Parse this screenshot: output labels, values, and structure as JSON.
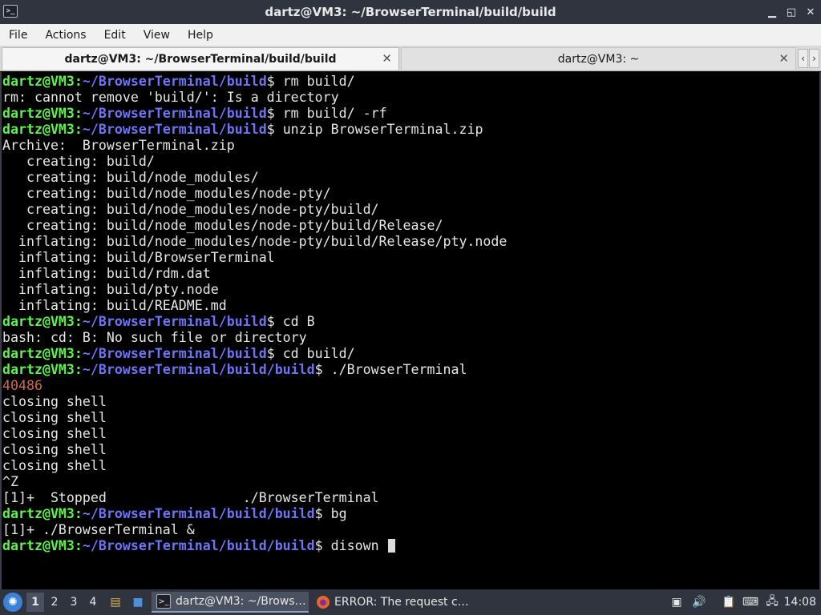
{
  "window": {
    "title": "dartz@VM3: ~/BrowserTerminal/build/build",
    "buttons": {
      "minimize": "▁",
      "maximize": "◱",
      "close": "✕"
    }
  },
  "menu": [
    "File",
    "Actions",
    "Edit",
    "View",
    "Help"
  ],
  "tabs": [
    {
      "label": "dartz@VM3: ~/BrowserTerminal/build/build",
      "active": true,
      "close": "✕"
    },
    {
      "label": "dartz@VM3: ~",
      "active": false,
      "close": "✕"
    }
  ],
  "tab_scroll": {
    "left": "‹",
    "right": "›"
  },
  "terminal": {
    "prompt_user": "dartz@VM3",
    "prompt_sep": ":",
    "lines": [
      {
        "type": "prompt",
        "path": "~/BrowserTerminal/build",
        "cmd": "rm build/"
      },
      {
        "type": "out",
        "text": "rm: cannot remove 'build/': Is a directory"
      },
      {
        "type": "prompt",
        "path": "~/BrowserTerminal/build",
        "cmd": "rm build/ -rf"
      },
      {
        "type": "prompt",
        "path": "~/BrowserTerminal/build",
        "cmd": "unzip BrowserTerminal.zip"
      },
      {
        "type": "out",
        "text": "Archive:  BrowserTerminal.zip"
      },
      {
        "type": "out",
        "text": "   creating: build/"
      },
      {
        "type": "out",
        "text": "   creating: build/node_modules/"
      },
      {
        "type": "out",
        "text": "   creating: build/node_modules/node-pty/"
      },
      {
        "type": "out",
        "text": "   creating: build/node_modules/node-pty/build/"
      },
      {
        "type": "out",
        "text": "   creating: build/node_modules/node-pty/build/Release/"
      },
      {
        "type": "out",
        "text": "  inflating: build/node_modules/node-pty/build/Release/pty.node"
      },
      {
        "type": "out",
        "text": "  inflating: build/BrowserTerminal"
      },
      {
        "type": "out",
        "text": "  inflating: build/rdm.dat"
      },
      {
        "type": "out",
        "text": "  inflating: build/pty.node"
      },
      {
        "type": "out",
        "text": "  inflating: build/README.md"
      },
      {
        "type": "prompt",
        "path": "~/BrowserTerminal/build",
        "cmd": "cd B"
      },
      {
        "type": "out",
        "text": "bash: cd: B: No such file or directory"
      },
      {
        "type": "prompt",
        "path": "~/BrowserTerminal/build",
        "cmd": "cd build/"
      },
      {
        "type": "prompt",
        "path": "~/BrowserTerminal/build/build",
        "cmd": "./BrowserTerminal"
      },
      {
        "type": "num",
        "text": "40486"
      },
      {
        "type": "out",
        "text": "closing shell"
      },
      {
        "type": "out",
        "text": "closing shell"
      },
      {
        "type": "out",
        "text": "closing shell"
      },
      {
        "type": "out",
        "text": "closing shell"
      },
      {
        "type": "out",
        "text": "closing shell"
      },
      {
        "type": "out",
        "text": "^Z"
      },
      {
        "type": "out",
        "text": "[1]+  Stopped                 ./BrowserTerminal"
      },
      {
        "type": "prompt",
        "path": "~/BrowserTerminal/build/build",
        "cmd": "bg"
      },
      {
        "type": "out",
        "text": "[1]+ ./BrowserTerminal &"
      },
      {
        "type": "prompt",
        "path": "~/BrowserTerminal/build/build",
        "cmd": "disown ",
        "cursor": true
      }
    ]
  },
  "taskbar": {
    "start_icon": "✺",
    "workspaces": [
      "1",
      "2",
      "3",
      "4"
    ],
    "active_workspace": "1",
    "launchers": [
      {
        "name": "file-manager-icon",
        "glyph": "▤"
      },
      {
        "name": "desktop-icon",
        "glyph": "■"
      }
    ],
    "tasks": [
      {
        "label": "dartz@VM3: ~/Brows…",
        "icon": "terminal-icon",
        "glyph": ">_",
        "active": true
      },
      {
        "label": "ERROR: The request c…",
        "icon": "firefox-icon",
        "glyph": "●",
        "active": false
      }
    ],
    "tray": [
      {
        "name": "window-list-icon",
        "glyph": "▣"
      },
      {
        "name": "volume-icon",
        "glyph": "🔊"
      },
      {
        "name": "clipboard-icon",
        "glyph": "📋"
      },
      {
        "name": "keyboard-icon",
        "glyph": "⌨"
      },
      {
        "name": "network-icon",
        "glyph": "🖧"
      }
    ],
    "clock": "14:08"
  },
  "colors": {
    "prompt_user": "#5ff24f",
    "prompt_path": "#6d74f5",
    "number_output": "#cc6b4a",
    "terminal_bg": "#000000",
    "taskbar_bg": "#2f343f"
  }
}
